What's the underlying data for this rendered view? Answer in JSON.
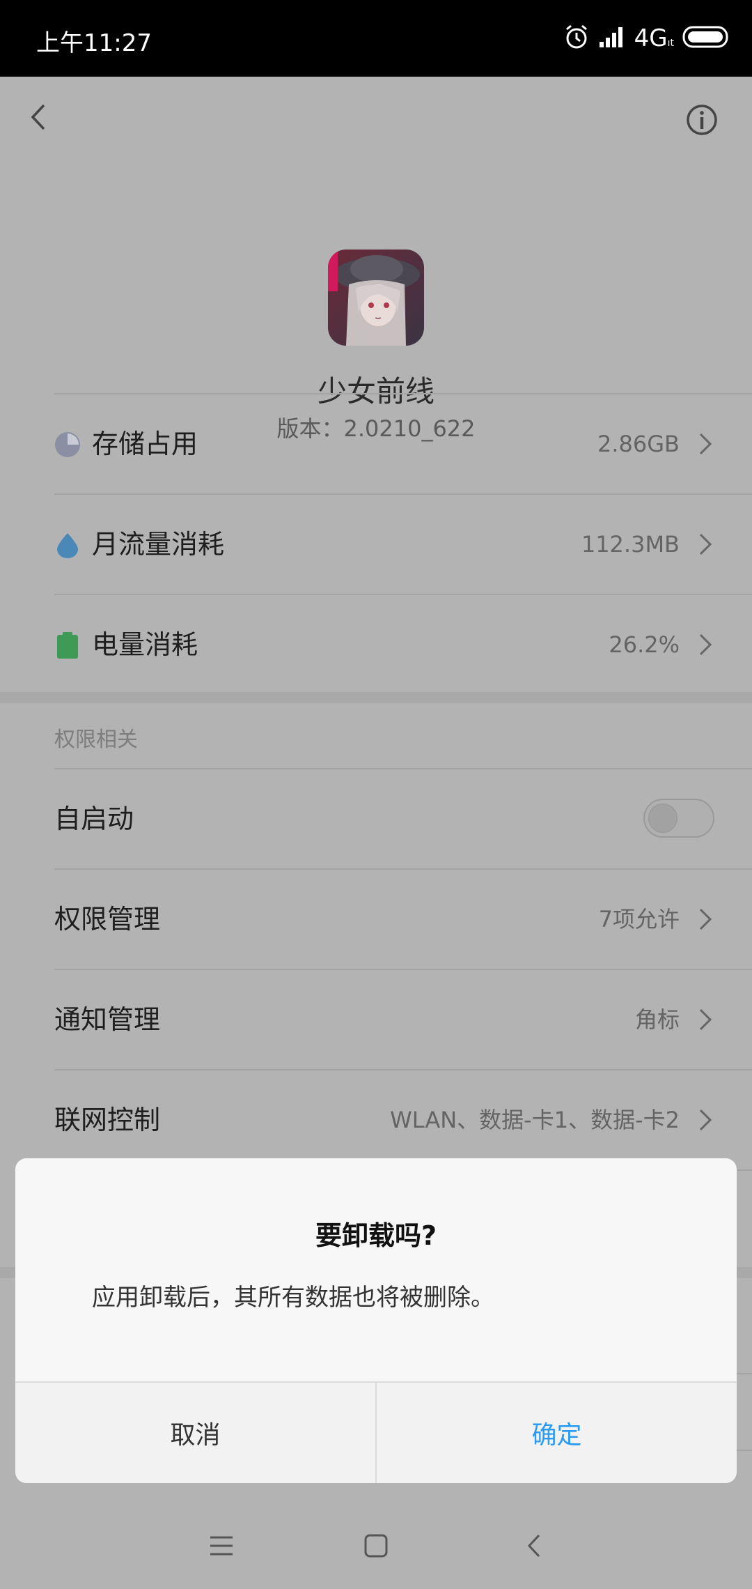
{
  "status_bar": {
    "time": "上午11:27",
    "network": "4G",
    "network_suffix": "ıt",
    "icons": [
      "alarm-icon",
      "signal-icon",
      "battery-icon"
    ]
  },
  "header": {
    "icons": [
      "back-arrow-icon",
      "info-icon"
    ]
  },
  "app": {
    "name": "少女前线",
    "version": "版本：2.0210_622"
  },
  "usage_rows": [
    {
      "label": "存储占用",
      "value": "2.86GB",
      "icon": "pie-chart-icon",
      "icon_color": "#8a8fa3"
    },
    {
      "label": "月流量消耗",
      "value": "112.3MB",
      "icon": "water-drop-icon",
      "icon_color": "#4a88b8"
    },
    {
      "label": "电量消耗",
      "value": "26.2%",
      "icon": "battery-icon",
      "icon_color": "#3f9a55"
    }
  ],
  "permissions": {
    "section_title": "权限相关",
    "autostart_label": "自启动",
    "autostart_on": false,
    "rows": [
      {
        "label": "权限管理",
        "value": "7项允许"
      },
      {
        "label": "通知管理",
        "value": "角标"
      },
      {
        "label": "联网控制",
        "value": "WLAN、数据-卡1、数据-卡2"
      }
    ]
  },
  "dialog": {
    "title": "要卸载吗?",
    "message": "应用卸载后，其所有数据也将被删除。",
    "cancel_label": "取消",
    "confirm_label": "确定",
    "confirm_color": "#2b9af3"
  },
  "navigation_bar": {
    "icons": [
      "menu-icon",
      "home-icon",
      "back-icon"
    ]
  }
}
